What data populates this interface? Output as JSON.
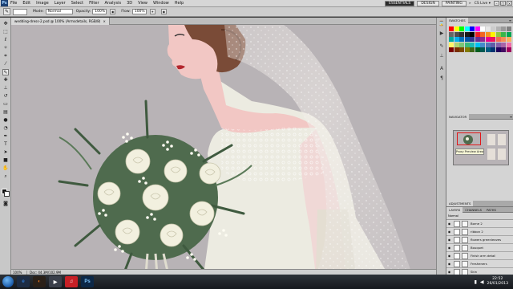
{
  "app": {
    "logo": "Ps",
    "menus": [
      "File",
      "Edit",
      "Image",
      "Layer",
      "Select",
      "Filter",
      "Analysis",
      "3D",
      "View",
      "Window",
      "Help"
    ],
    "workspaces": [
      "ESSENTIALS",
      "DESIGN",
      "PAINTING"
    ],
    "active_workspace": "ESSENTIALS",
    "overflow": "»",
    "cs_live": "CS Live ▾"
  },
  "options": {
    "mode_label": "Mode:",
    "mode_value": "Normal",
    "opacity_label": "Opacity:",
    "opacity_value": "100%",
    "flow_label": "Flow:",
    "flow_value": "100%"
  },
  "document": {
    "tab_title": "wedding-dress-2.psd @ 100% (Armsdetails, RGB/8)",
    "close_glyph": "×",
    "status_zoom": "100%",
    "status_info": "Doc: 44.3M/102.9M"
  },
  "panels": {
    "swatches_tab": "SWATCHES",
    "navigator_tab": "NAVIGATOR",
    "proxy_label": "Proxy Preview Area",
    "adjustments_tab": "ADJUSTMENTS",
    "layers_tab": "LAYERS",
    "channels_tab": "CHANNELS",
    "paths_tab": "PATHS",
    "layer_mode": "Normal"
  },
  "layers": [
    {
      "name": "Borne 2",
      "selected": false
    },
    {
      "name": "ribbon 2",
      "selected": false
    },
    {
      "name": "flowers greenleaves",
      "selected": false
    },
    {
      "name": "Bouquet",
      "selected": false
    },
    {
      "name": "Finish arm detail",
      "selected": false
    },
    {
      "name": "Fresheners",
      "selected": false
    },
    {
      "name": "Skin",
      "selected": false
    },
    {
      "name": "lace details",
      "selected": false
    },
    {
      "name": "Armsdetails",
      "selected": true
    }
  ],
  "swatch_colors": [
    "#ff0000",
    "#ffff00",
    "#00ff00",
    "#00ffff",
    "#0000ff",
    "#ff00ff",
    "#ffffff",
    "#e6e6e6",
    "#cccccc",
    "#b3b3b3",
    "#999999",
    "#808080",
    "#666666",
    "#4d4d4d",
    "#333333",
    "#1a1a1a",
    "#000000",
    "#ed1c24",
    "#f26522",
    "#f7941d",
    "#fff200",
    "#8dc63f",
    "#39b54a",
    "#00a651",
    "#00a99d",
    "#00aeef",
    "#0072bc",
    "#0054a6",
    "#2e3192",
    "#662d91",
    "#92278f",
    "#ec008c",
    "#ed145b",
    "#f26c4f",
    "#f68e55",
    "#fbaf5c",
    "#fff568",
    "#acd373",
    "#7cc576",
    "#3bb878",
    "#1abbb4",
    "#00bff3",
    "#448ccb",
    "#5674b9",
    "#605ca8",
    "#8560a8",
    "#a864a8",
    "#f06eaa",
    "#790000",
    "#7b2e00",
    "#7d4900",
    "#827b00",
    "#406618",
    "#005e20",
    "#005952",
    "#005b7f",
    "#003471",
    "#21005d",
    "#440e62",
    "#9e005d"
  ],
  "taskbar": {
    "apps": [
      {
        "label": "e",
        "color": "#2e7ad1",
        "bg": "#1d2c44"
      },
      {
        "label": "◐",
        "color": "#f47b20",
        "bg": "#2a2018"
      },
      {
        "label": "▶",
        "color": "#ffffff",
        "bg": "#3a3f4a"
      },
      {
        "label": "♫",
        "color": "#ffffff",
        "bg": "#c62026"
      },
      {
        "label": "Ps",
        "color": "#7fc6ff",
        "bg": "#0d2847"
      }
    ],
    "time": "22:52",
    "date": "26/01/2013"
  },
  "colors": {
    "canvas_bg": "#b8b3b6",
    "skin": "#f3c9c6",
    "hair": "#7a4b37",
    "leaf": "#4f6b4e",
    "rose": "#f2f0df",
    "selection": "#3b6dd1"
  }
}
